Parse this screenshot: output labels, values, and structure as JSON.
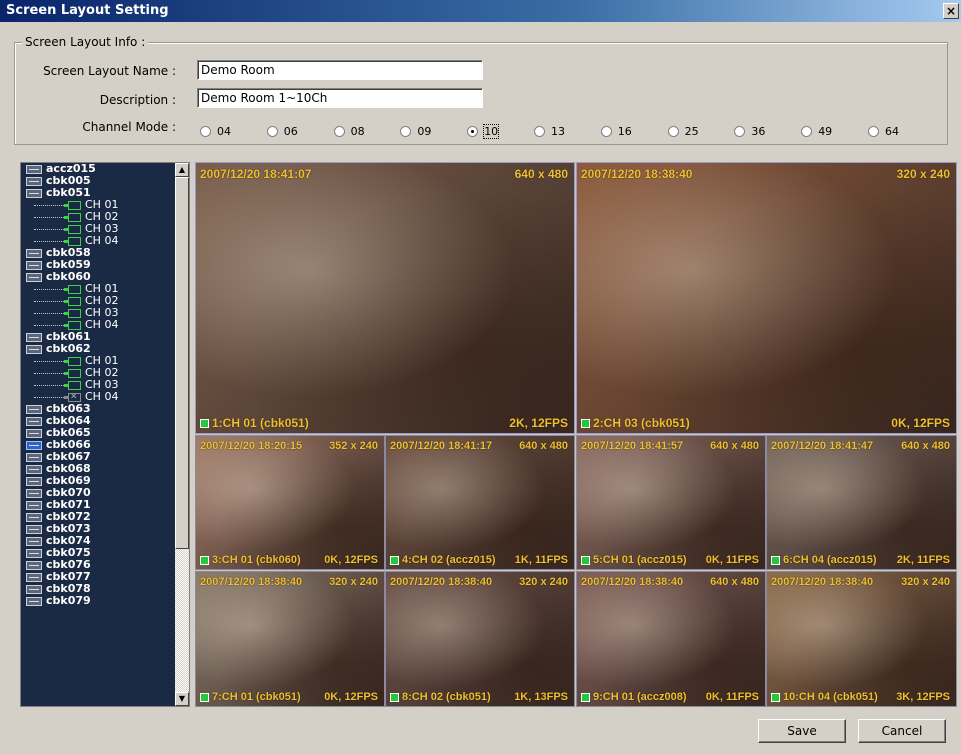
{
  "window": {
    "title": "Screen Layout Setting",
    "close": "×"
  },
  "info": {
    "group_label": "Screen Layout Info :",
    "name_label": "Screen Layout Name :",
    "name_value": "Demo Room",
    "desc_label": "Description :",
    "desc_value": "Demo Room 1~10Ch",
    "mode_label": "Channel Mode :"
  },
  "channel_modes": [
    "04",
    "06",
    "08",
    "09",
    "10",
    "13",
    "16",
    "25",
    "36",
    "49",
    "64"
  ],
  "channel_mode_selected": "10",
  "tree": {
    "nodes": [
      {
        "name": "accz015",
        "children": []
      },
      {
        "name": "cbk005",
        "children": []
      },
      {
        "name": "cbk051",
        "children": [
          "CH 01",
          "CH 02",
          "CH 03",
          "CH 04"
        ]
      },
      {
        "name": "cbk058",
        "children": []
      },
      {
        "name": "cbk059",
        "children": []
      },
      {
        "name": "cbk060",
        "children": [
          "CH 01",
          "CH 02",
          "CH 03",
          "CH 04"
        ]
      },
      {
        "name": "cbk061",
        "children": []
      },
      {
        "name": "cbk062",
        "children": [
          "CH 01",
          "CH 02",
          "CH 03",
          "CH 04"
        ]
      },
      {
        "name": "cbk063",
        "children": []
      },
      {
        "name": "cbk064",
        "children": []
      },
      {
        "name": "cbk065",
        "children": []
      },
      {
        "name": "cbk066",
        "children": []
      },
      {
        "name": "cbk067",
        "children": []
      },
      {
        "name": "cbk068",
        "children": []
      },
      {
        "name": "cbk069",
        "children": []
      },
      {
        "name": "cbk070",
        "children": []
      },
      {
        "name": "cbk071",
        "children": []
      },
      {
        "name": "cbk072",
        "children": []
      },
      {
        "name": "cbk073",
        "children": []
      },
      {
        "name": "cbk074",
        "children": []
      },
      {
        "name": "cbk075",
        "children": []
      },
      {
        "name": "cbk076",
        "children": []
      },
      {
        "name": "cbk077",
        "children": []
      },
      {
        "name": "cbk078",
        "children": []
      },
      {
        "name": "cbk079",
        "children": []
      }
    ],
    "selected": "cbk066",
    "disabled_child": {
      "parent": "cbk062",
      "child": "CH 04"
    }
  },
  "tiles": [
    {
      "ts": "2007/12/20 18:41:07",
      "res": "640 x 480",
      "label": "1:CH 01 (cbk051)",
      "stat": "2K, 12FPS",
      "color": "#7a5e4c"
    },
    {
      "ts": "2007/12/20 18:38:40",
      "res": "320 x 240",
      "label": "2:CH 03 (cbk051)",
      "stat": "0K, 12FPS",
      "color": "#8c5a3c"
    },
    {
      "ts": "2007/12/20 18:20:15",
      "res": "352 x 240",
      "label": "3:CH 01 (cbk060)",
      "stat": "0K, 12FPS",
      "color": "#a07a68"
    },
    {
      "ts": "2007/12/20 18:41:17",
      "res": "640 x 480",
      "label": "4:CH 02 (accz015)",
      "stat": "1K, 11FPS",
      "color": "#6a4e40"
    },
    {
      "ts": "2007/12/20 18:41:57",
      "res": "640 x 480",
      "label": "5:CH 01 (accz015)",
      "stat": "0K, 11FPS",
      "color": "#8a6a60"
    },
    {
      "ts": "2007/12/20 18:41:47",
      "res": "640 x 480",
      "label": "6:CH 04 (accz015)",
      "stat": "2K, 11FPS",
      "color": "#76655a"
    },
    {
      "ts": "2007/12/20 18:38:40",
      "res": "320 x 240",
      "label": "7:CH 01 (cbk051)",
      "stat": "0K, 12FPS",
      "color": "#8a7a6c"
    },
    {
      "ts": "2007/12/20 18:38:40",
      "res": "320 x 240",
      "label": "8:CH 02 (cbk051)",
      "stat": "1K, 13FPS",
      "color": "#6a5048"
    },
    {
      "ts": "2007/12/20 18:38:40",
      "res": "640 x 480",
      "label": "9:CH 01 (accz008)",
      "stat": "0K, 11FPS",
      "color": "#7e5e58"
    },
    {
      "ts": "2007/12/20 18:38:40",
      "res": "320 x 240",
      "label": "10:CH 04 (cbk051)",
      "stat": "3K, 12FPS",
      "color": "#8c6a4a"
    }
  ],
  "buttons": {
    "save": "Save",
    "cancel": "Cancel"
  }
}
